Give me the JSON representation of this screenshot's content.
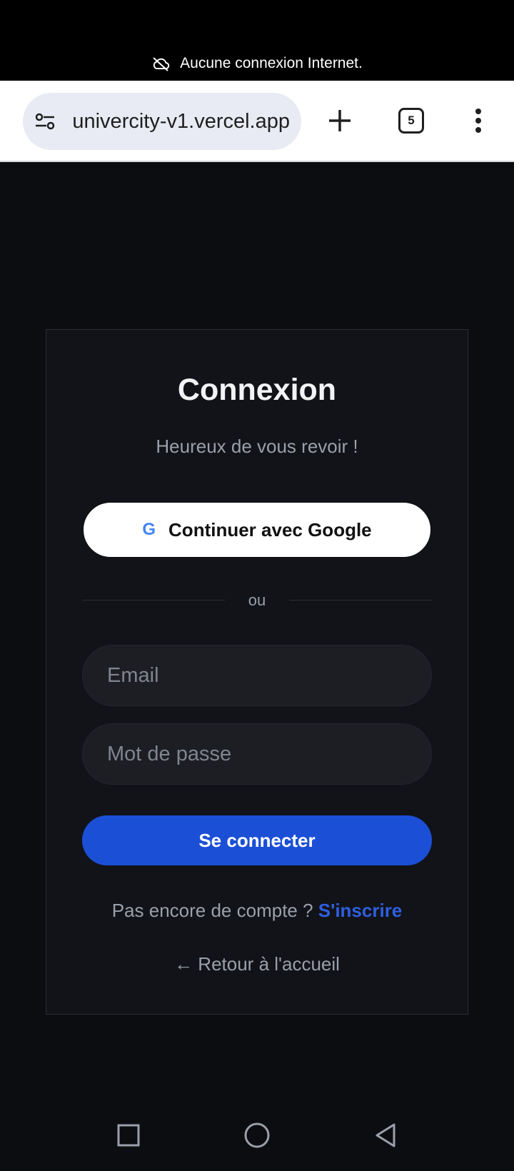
{
  "status_bar": {
    "message": "Aucune connexion Internet.",
    "icon": "cloud-off-icon"
  },
  "browser": {
    "url": "univercity-v1.vercel.app",
    "tab_count": "5",
    "icons": [
      "tune-icon",
      "plus-icon",
      "tabs-icon",
      "more-vert-icon"
    ]
  },
  "login": {
    "title": "Connexion",
    "subtitle": "Heureux de vous revoir !",
    "google_icon_letter": "G",
    "google_button": "Continuer avec Google",
    "divider": "ou",
    "email_placeholder": "Email",
    "password_placeholder": "Mot de passe",
    "submit_button": "Se connecter",
    "no_account_text": "Pas encore de compte ?",
    "signup_link": "S'inscrire",
    "back_link": "← Retour à l'accueil"
  },
  "colors": {
    "background": "#0c0d11",
    "card": "#111318",
    "primary": "#1b4fd6",
    "link": "#2f5fe0"
  },
  "nav_bar": {
    "icons": [
      "recents-icon",
      "home-icon",
      "back-icon"
    ]
  }
}
